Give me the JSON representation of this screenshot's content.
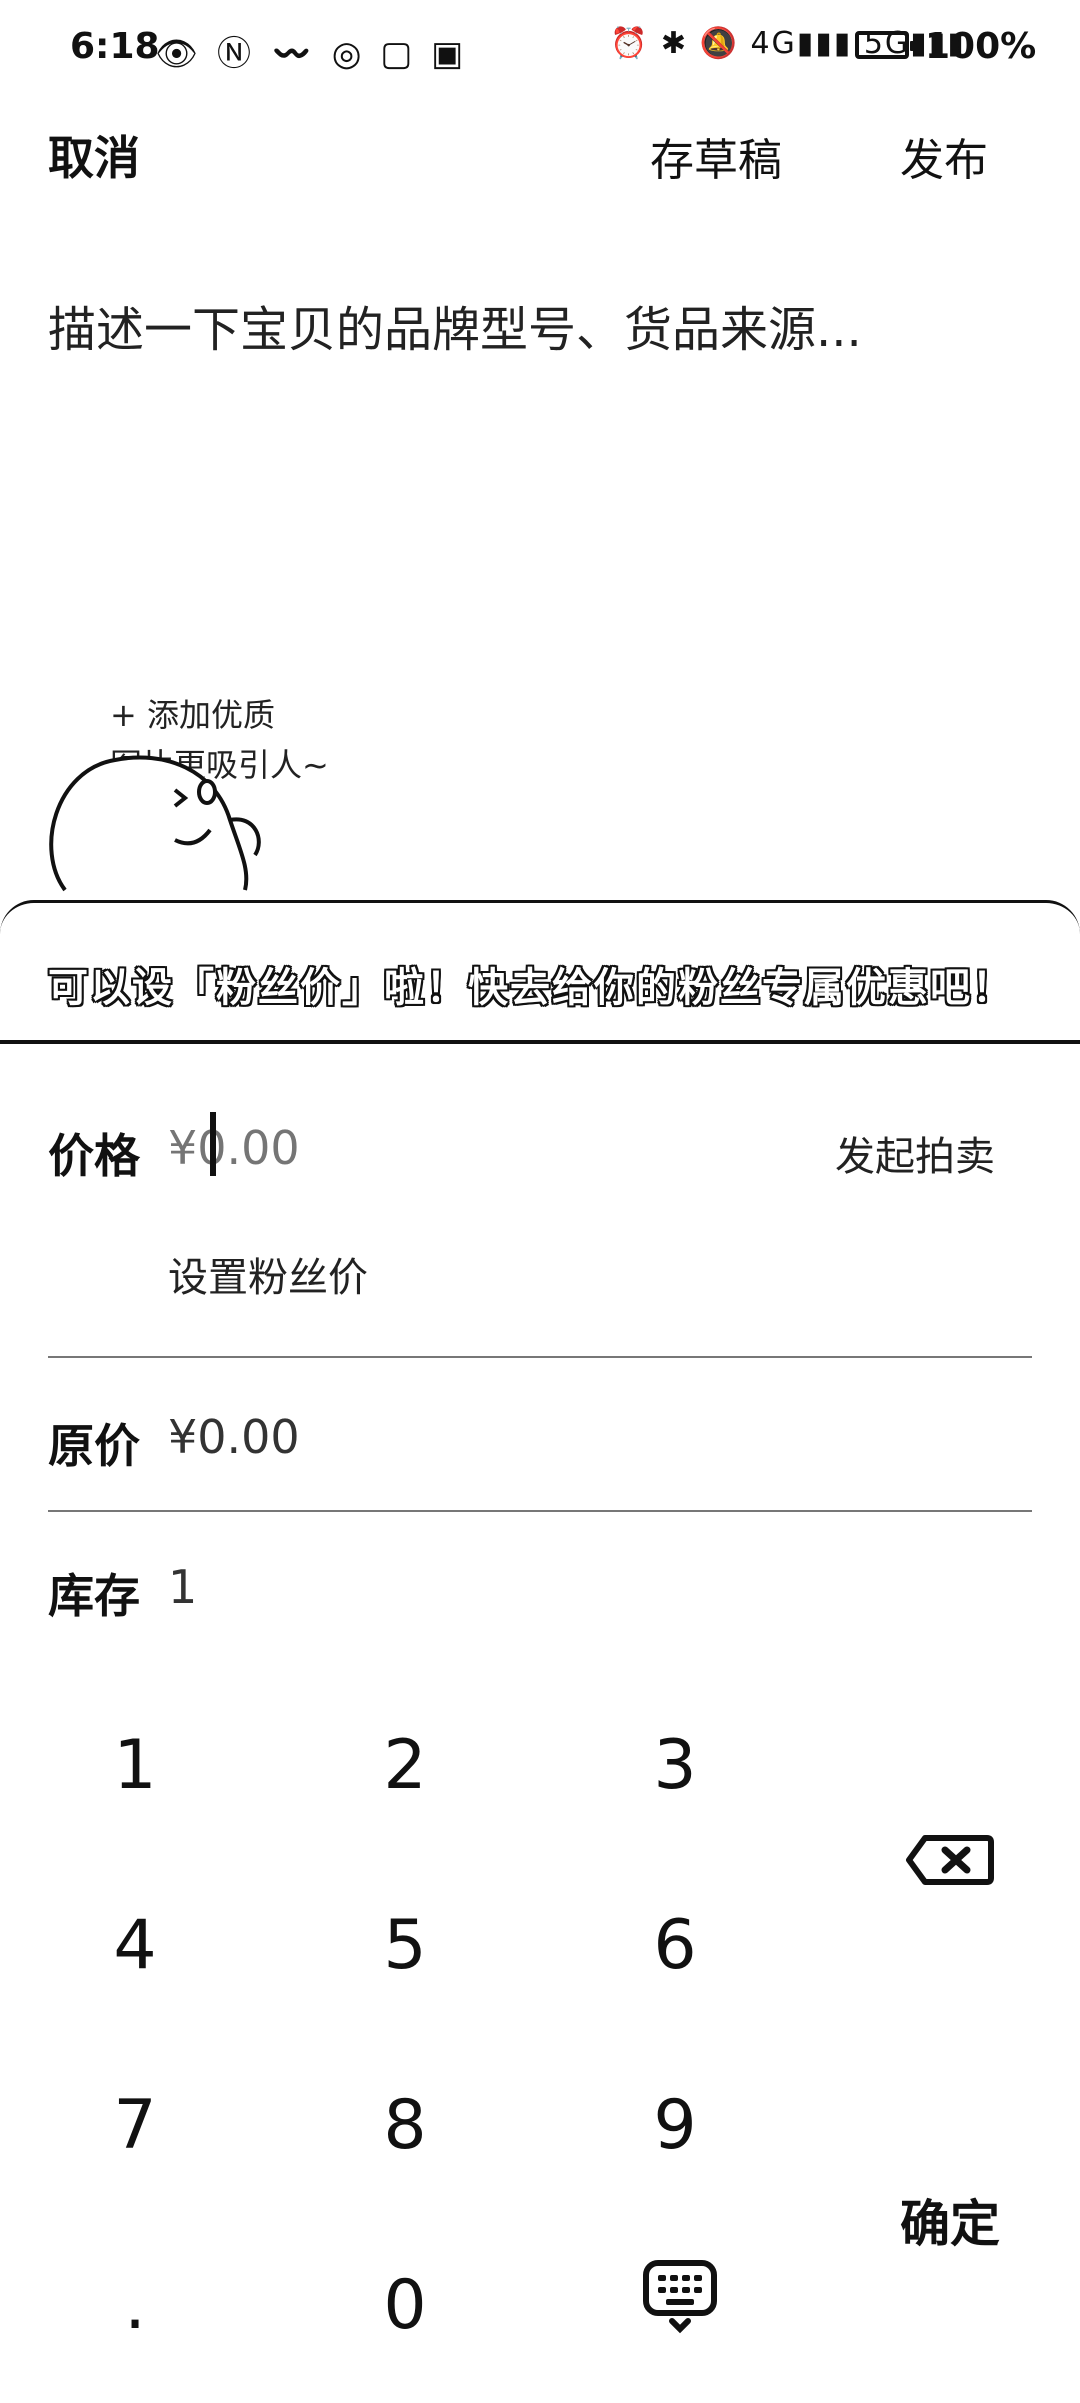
{
  "status_bar": {
    "time": "6:18",
    "left_icons": [
      "eye-icon",
      "nfc-icon",
      "wifi-like-icon",
      "app-icon",
      "notification-icon"
    ],
    "battery_percent": "100%"
  },
  "header": {
    "cancel_label": "取消",
    "draft_label": "存草稿",
    "publish_label": "发布"
  },
  "description": {
    "placeholder": "描述一下宝贝的品牌型号、货品来源..."
  },
  "mascot": {
    "hint_line1": "+ 添加优质",
    "hint_line2": "图片更吸引人~"
  },
  "banner": {
    "text": "可以设「粉丝价」啦！快去给你的粉丝专属优惠吧！"
  },
  "price": {
    "label": "价格",
    "placeholder": "¥0.00",
    "auction_label": "发起拍卖",
    "fan_price_label": "设置粉丝价"
  },
  "original_price": {
    "label": "原价",
    "value": "¥0.00"
  },
  "stock": {
    "label": "库存",
    "value": "1"
  },
  "keypad": {
    "keys": [
      "1",
      "2",
      "3",
      "4",
      "5",
      "6",
      "7",
      "8",
      "9",
      ".",
      "0"
    ],
    "confirm_label": "确定",
    "delete_icon": "backspace-icon",
    "keyboard_icon": "keyboard-icon"
  }
}
